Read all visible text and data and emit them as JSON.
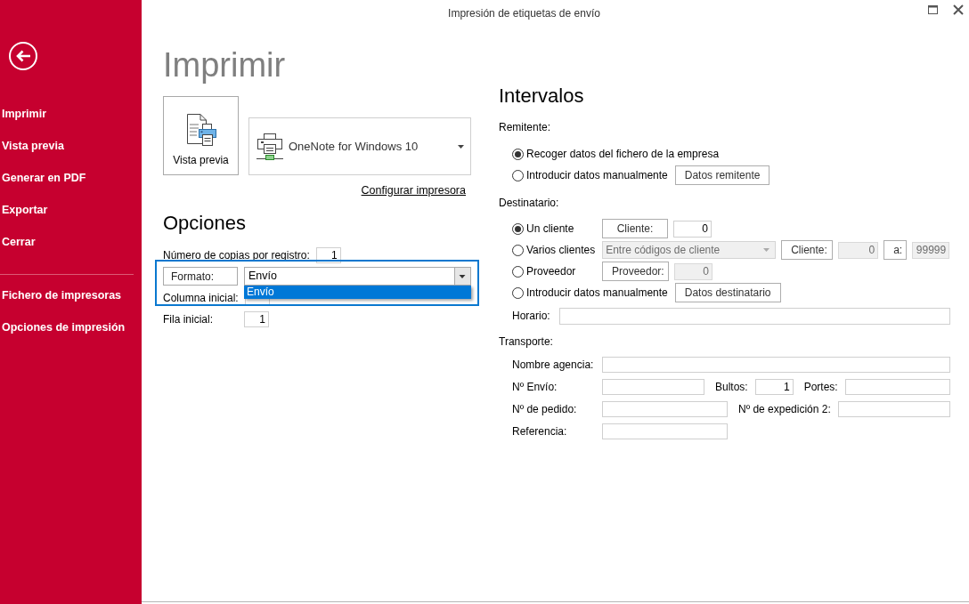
{
  "window": {
    "title": "Impresión de etiquetas de envío"
  },
  "sidebar": {
    "groups": [
      {
        "items": [
          {
            "label": "Imprimir"
          },
          {
            "label": "Vista previa"
          },
          {
            "label": "Generar en PDF"
          },
          {
            "label": "Exportar"
          },
          {
            "label": "Cerrar"
          }
        ]
      },
      {
        "items": [
          {
            "label": "Fichero de impresoras"
          },
          {
            "label": "Opciones de impresión"
          }
        ]
      }
    ]
  },
  "print": {
    "title": "Imprimir",
    "preview_button": {
      "label": "Vista previa"
    },
    "printer": {
      "name": "OneNote for Windows 10"
    },
    "setup_link": {
      "label": "Configurar impresora"
    }
  },
  "options": {
    "heading": "Opciones",
    "rows": [
      {
        "kind": "number",
        "label": "Número de copias por registro:",
        "value": "1"
      },
      {
        "kind": "combo",
        "label": "Formato:",
        "value": "Envío",
        "focused": true,
        "expanded": true,
        "items": [
          {
            "label": "Envío",
            "selected": true
          }
        ]
      },
      {
        "kind": "number",
        "label": "Columna inicial:"
      },
      {
        "kind": "number",
        "label": "Fila inicial:",
        "value": "1"
      }
    ]
  },
  "intervals": {
    "heading": "Intervalos",
    "sender": {
      "label": "Remitente:",
      "options": [
        {
          "label": "Recoger datos del fichero de la empresa",
          "selected": true
        },
        {
          "label": "Introducir datos manualmente",
          "selected": false,
          "controls": [
            {
              "kind": "button",
              "label": "Datos remitente"
            }
          ]
        }
      ]
    },
    "recipient": {
      "label": "Destinatario:",
      "options": [
        {
          "label": "Un cliente",
          "selected": true,
          "controls": [
            {
              "kind": "button",
              "label": "Cliente:"
            },
            {
              "kind": "field",
              "value": "0",
              "disabled": false
            }
          ]
        },
        {
          "label": "Varios clientes",
          "selected": false,
          "controls": [
            {
              "kind": "select",
              "value": "Entre códigos de cliente",
              "disabled": true
            },
            {
              "kind": "button",
              "label": "Cliente:"
            },
            {
              "kind": "field",
              "value": "0",
              "disabled": true
            },
            {
              "kind": "button",
              "label": "a:"
            },
            {
              "kind": "field",
              "value": "99999",
              "disabled": true
            }
          ]
        },
        {
          "label": "Proveedor",
          "selected": false,
          "controls": [
            {
              "kind": "button",
              "label": "Proveedor:"
            },
            {
              "kind": "field",
              "value": "0",
              "disabled": true
            }
          ]
        },
        {
          "label": "Introducir datos manualmente",
          "selected": false,
          "controls": [
            {
              "kind": "button",
              "label": "Datos destinatario"
            }
          ]
        }
      ]
    },
    "schedule": {
      "label": "Horario:"
    }
  },
  "transport": {
    "label": "Transporte:",
    "rows": [
      [
        {
          "label": "Nombre agencia:"
        }
      ],
      [
        {
          "label": "Nº Envío:"
        },
        {
          "label": "Bultos:",
          "value": "1"
        },
        {
          "label": "Portes:"
        }
      ],
      [
        {
          "label": "Nº de pedido:"
        },
        {
          "label": "Nº de expedición 2:"
        }
      ],
      [
        {
          "label": "Referencia:"
        }
      ]
    ]
  }
}
